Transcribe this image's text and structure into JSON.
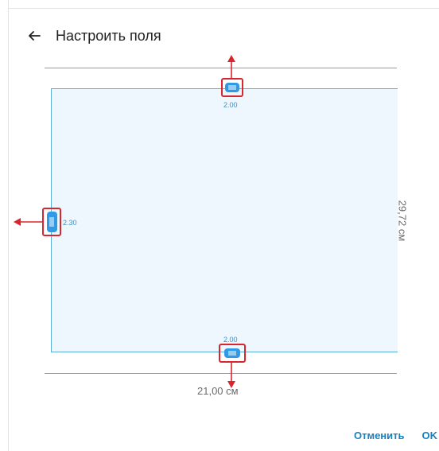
{
  "header": {
    "back_icon": "arrow-left-icon",
    "title": "Настроить поля"
  },
  "margins": {
    "top": "2.00",
    "left": "2.30",
    "bottom": "2.00"
  },
  "page_size": {
    "width_label": "21,00 см",
    "height_label": "29,72 см"
  },
  "actions": {
    "cancel_label": "Отменить",
    "ok_label": "OK"
  },
  "colors": {
    "accent": "#1b7fba",
    "edge_line": "#5ab0d6",
    "page_fill": "#eef7fd",
    "handle": "#2f9be6",
    "annotation_red": "#d8262f"
  },
  "icons": {
    "drag_handle": "drag-handle-icon",
    "drag_arrow": "drag-arrow-icon"
  }
}
